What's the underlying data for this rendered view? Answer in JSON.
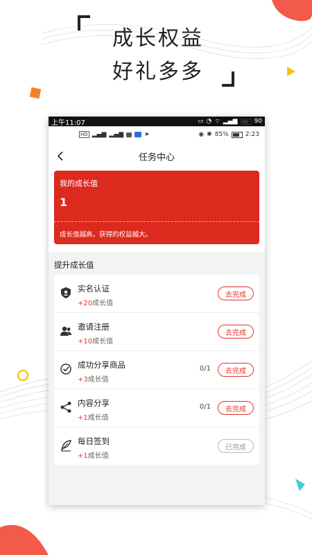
{
  "promo": {
    "line1": "成长权益",
    "line2": "好礼多多"
  },
  "system_bar": {
    "time": "上午11:07",
    "battery": "90"
  },
  "status_bar": {
    "network": "HD",
    "battery_percent": "85%",
    "clock": "2:23"
  },
  "nav": {
    "title": "任务中心"
  },
  "growth": {
    "label": "我的成长值",
    "value": "1",
    "note": "成长值越高，获得的权益越大。"
  },
  "section": {
    "title": "提升成长值"
  },
  "tasks": [
    {
      "title": "实名认证",
      "points": "+20",
      "unit": "成长值",
      "progress": "",
      "button": "去完成",
      "done": false,
      "icon": "shield-user-icon"
    },
    {
      "title": "邀请注册",
      "points": "+10",
      "unit": "成长值",
      "progress": "",
      "button": "去完成",
      "done": false,
      "icon": "invite-user-icon"
    },
    {
      "title": "成功分享商品",
      "points": "+3",
      "unit": "成长值",
      "progress": "0/1",
      "button": "去完成",
      "done": false,
      "icon": "check-circle-icon"
    },
    {
      "title": "内容分享",
      "points": "+1",
      "unit": "成长值",
      "progress": "0/1",
      "button": "去完成",
      "done": false,
      "icon": "share-icon"
    },
    {
      "title": "每日签到",
      "points": "+1",
      "unit": "成长值",
      "progress": "",
      "button": "已完成",
      "done": true,
      "icon": "feather-sign-icon"
    }
  ],
  "colors": {
    "accent": "#dd2a1f",
    "points": "#e0352b"
  }
}
